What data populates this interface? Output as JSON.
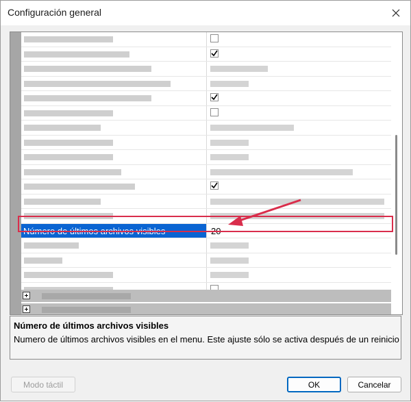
{
  "window": {
    "title": "Configuración general"
  },
  "grid": {
    "selected_row": {
      "name": "Número de últimos archivos visibles",
      "value": "20"
    }
  },
  "description": {
    "title": "Número de últimos archivos visibles",
    "text": "Numero de últimos archivos visibles en el menu. Este ajuste sólo se activa después de un reinicio"
  },
  "buttons": {
    "touch_mode": "Modo táctil",
    "ok": "OK",
    "cancel": "Cancelar"
  },
  "colors": {
    "selection": "#0a64d2",
    "highlight_annotation": "#d92d4b",
    "ok_border": "#0067c0"
  },
  "icons": [
    "close-icon",
    "checkbox-icon",
    "expand-plus-icon",
    "annotation-arrow-icon"
  ]
}
